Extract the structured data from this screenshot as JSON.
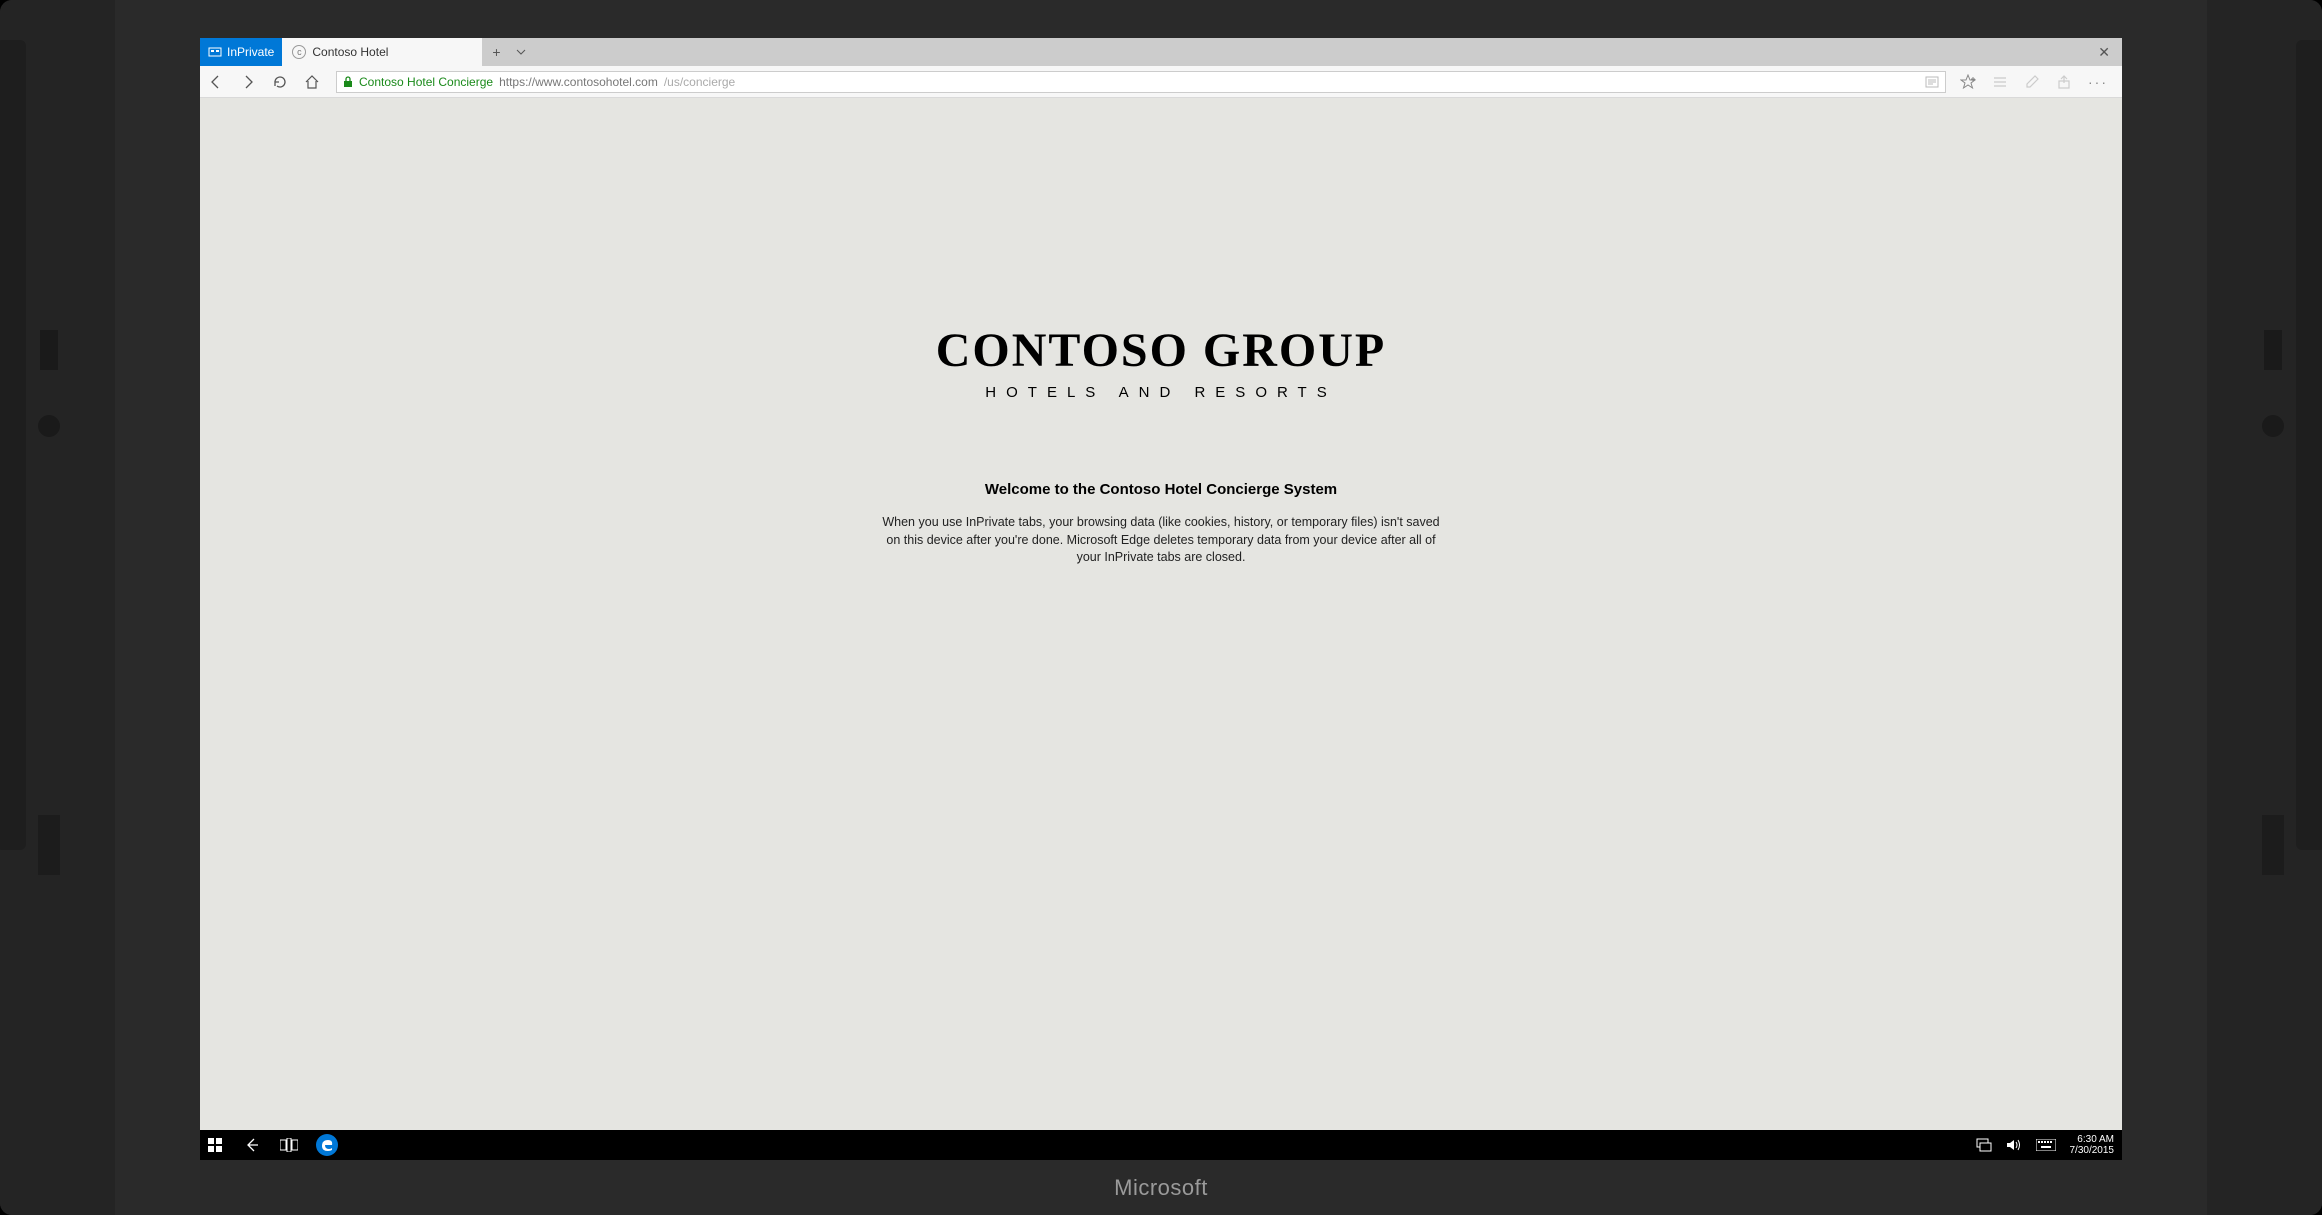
{
  "device": {
    "brand": "Microsoft"
  },
  "browser": {
    "inprivate_label": "InPrivate",
    "tab_title": "Contoso Hotel",
    "site_label": "Contoso Hotel Concierge",
    "url_prefix": "https://",
    "url_host": "www.contosohotel.com",
    "url_path": "/us/concierge"
  },
  "page": {
    "logo_main": "CONTOSO GROUP",
    "logo_sub": "HOTELS AND RESORTS",
    "welcome": "Welcome to the Contoso Hotel Concierge System",
    "description": "When you use InPrivate tabs, your browsing data (like cookies, history, or temporary files) isn't saved on this device after you're done. Microsoft Edge deletes temporary data from your device after all of your InPrivate tabs are closed."
  },
  "taskbar": {
    "time": "6:30 AM",
    "date": "7/30/2015"
  }
}
